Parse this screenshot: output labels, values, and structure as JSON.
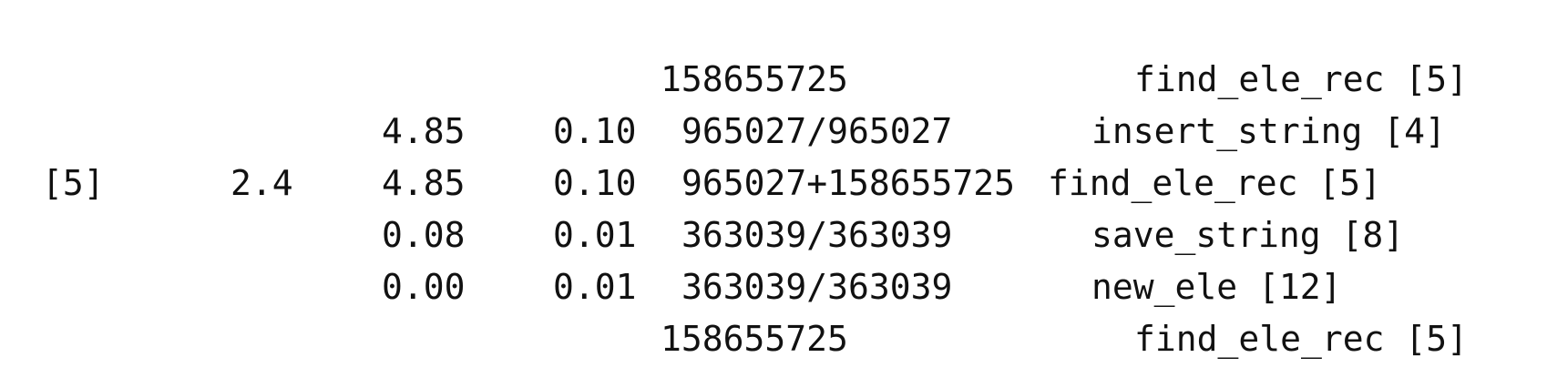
{
  "call_graph": {
    "rows": [
      {
        "index": "",
        "percent_time": "",
        "self": "",
        "children": "",
        "called": "158655725",
        "name": "find_ele_rec [5]"
      },
      {
        "index": "",
        "percent_time": "",
        "self": "4.85",
        "children": "0.10",
        "called": "965027/965027",
        "name": "insert_string [4]"
      },
      {
        "index": "[5]",
        "percent_time": "2.4",
        "self": "4.85",
        "children": "0.10",
        "called": "965027+158655725",
        "name": "find_ele_rec [5]"
      },
      {
        "index": "",
        "percent_time": "",
        "self": "0.08",
        "children": "0.01",
        "called": "363039/363039",
        "name": "save_string [8]"
      },
      {
        "index": "",
        "percent_time": "",
        "self": "0.00",
        "children": "0.01",
        "called": "363039/363039",
        "name": "new_ele [12]"
      },
      {
        "index": "",
        "percent_time": "",
        "self": "",
        "children": "",
        "called": "158655725",
        "name": "find_ele_rec [5]"
      }
    ]
  }
}
